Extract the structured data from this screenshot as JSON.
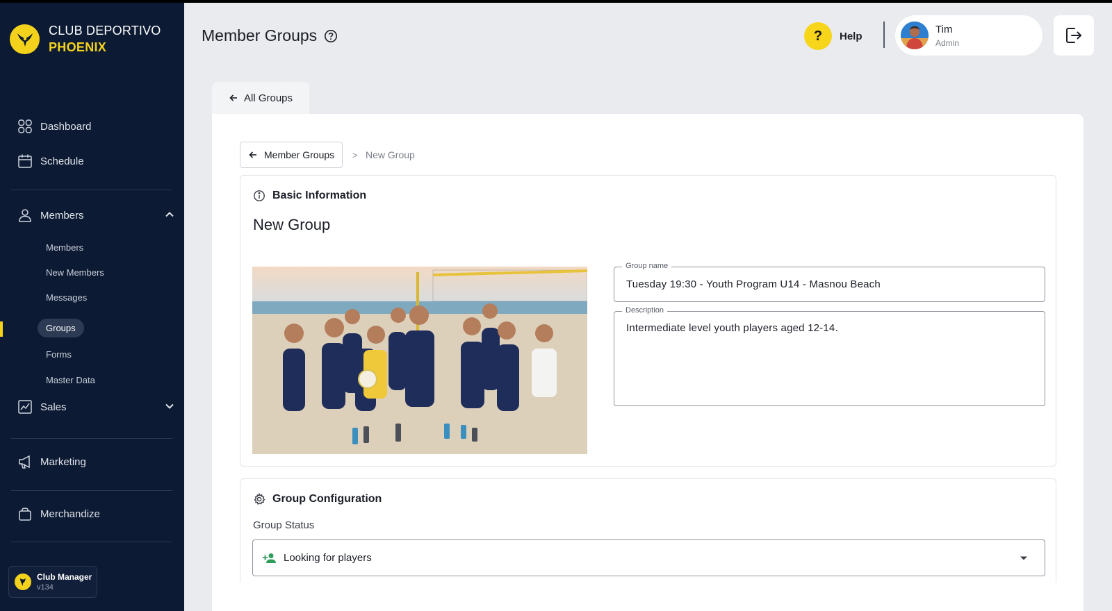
{
  "brand": {
    "line1": "CLUB DEPORTIVO",
    "line2": "PHOENIX"
  },
  "sidebar": {
    "nav": [
      {
        "label": "Dashboard",
        "icon": "grid-icon"
      },
      {
        "label": "Schedule",
        "icon": "calendar-icon"
      },
      {
        "label": "Members",
        "icon": "user-icon",
        "expanded": true
      },
      {
        "label": "Sales",
        "icon": "chart-icon",
        "expanded": false
      },
      {
        "label": "Marketing",
        "icon": "megaphone-icon"
      },
      {
        "label": "Merchandize",
        "icon": "bag-icon"
      }
    ],
    "member_sub": [
      "Members",
      "New Members",
      "Messages",
      "Groups",
      "Forms",
      "Master Data"
    ],
    "active_sub": "Groups",
    "footer": {
      "title": "Club Manager",
      "version": "v134"
    }
  },
  "header": {
    "title": "Member Groups",
    "help_label": "Help",
    "help_glyph": "?",
    "user": {
      "name": "Tim",
      "role": "Admin"
    }
  },
  "tabs": {
    "all_groups": "All Groups"
  },
  "breadcrumb": {
    "back_label": "Member Groups",
    "separator": ">",
    "current": "New Group"
  },
  "basic": {
    "section_title": "Basic Information",
    "heading": "New Group",
    "group_name_label": "Group name",
    "group_name_value": "Tuesday 19:30 - Youth Program U14 - Masnou Beach",
    "description_label": "Description",
    "description_value": "Intermediate level youth players aged 12-14."
  },
  "config": {
    "section_title": "Group Configuration",
    "status_label": "Group Status",
    "status_value": "Looking for players"
  },
  "colors": {
    "sidebar_bg": "#0c1a33",
    "accent_yellow": "#f4d21c",
    "page_bg": "#e9ebee",
    "status_green": "#2e9e5b"
  }
}
